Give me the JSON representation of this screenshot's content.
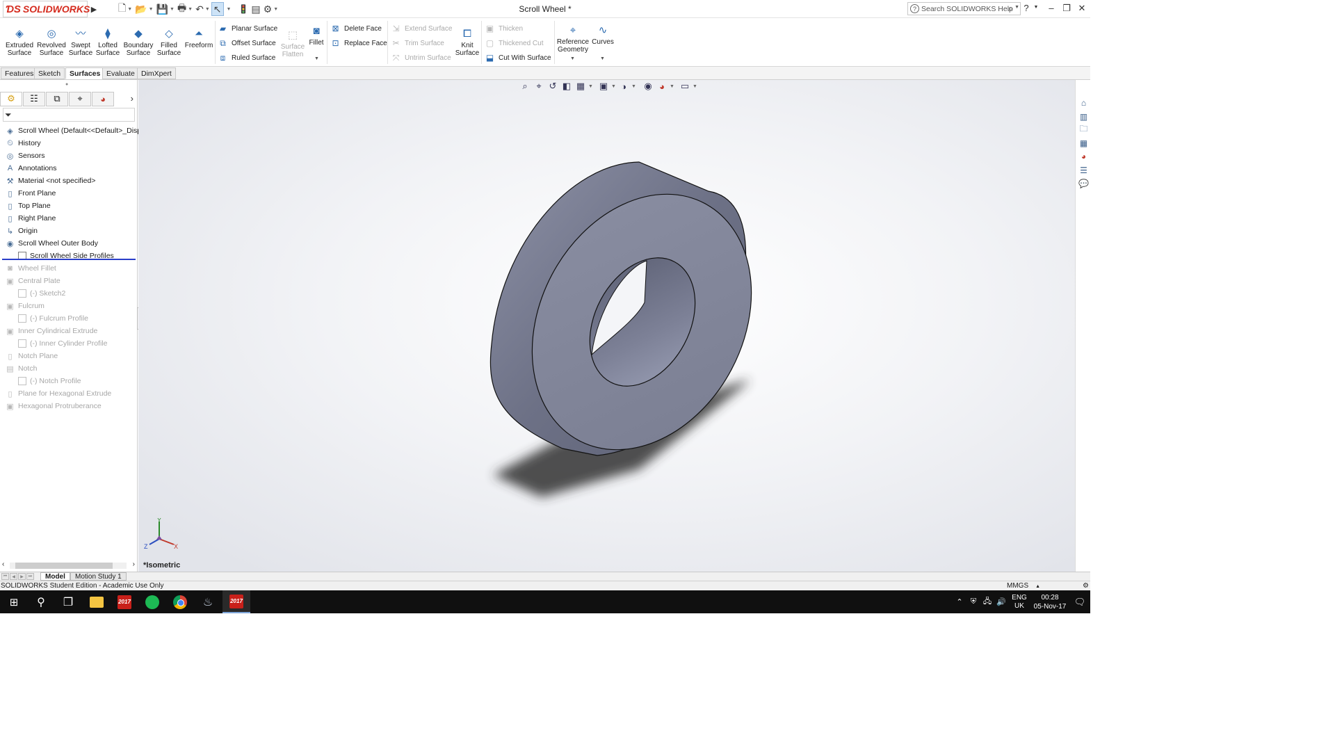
{
  "app": {
    "logo_text": "SOLIDWORKS",
    "document_title": "Scroll Wheel *",
    "help_search_placeholder": "Search SOLIDWORKS Help"
  },
  "ribbon": {
    "big_buttons": [
      {
        "label": "Extruded Surface",
        "icon": "extruded-surface-icon"
      },
      {
        "label": "Revolved Surface",
        "icon": "revolved-surface-icon"
      },
      {
        "label": "Swept Surface",
        "icon": "swept-surface-icon"
      },
      {
        "label": "Lofted Surface",
        "icon": "lofted-surface-icon"
      },
      {
        "label": "Boundary Surface",
        "icon": "boundary-surface-icon"
      },
      {
        "label": "Filled Surface",
        "icon": "filled-surface-icon"
      },
      {
        "label": "Freeform",
        "icon": "freeform-icon"
      }
    ],
    "group1": [
      "Planar Surface",
      "Offset Surface",
      "Ruled Surface"
    ],
    "surface_flatten": "Surface Flatten",
    "fillet": "Fillet",
    "group2": [
      "Delete Face",
      "Replace Face"
    ],
    "group3": [
      "Extend Surface",
      "Trim Surface",
      "Untrim Surface"
    ],
    "knit_surface": "Knit Surface",
    "group4": [
      "Thicken",
      "Thickened Cut",
      "Cut With Surface"
    ],
    "reference_geometry": "Reference Geometry",
    "curves": "Curves"
  },
  "tabs": [
    "Features",
    "Sketch",
    "Surfaces",
    "Evaluate",
    "DimXpert"
  ],
  "active_tab": "Surfaces",
  "tree": [
    {
      "label": "Scroll Wheel  (Default<<Default>_Displ",
      "icon": "part-icon",
      "suppressed": false,
      "indent": 0
    },
    {
      "label": "History",
      "icon": "history-icon",
      "suppressed": false,
      "indent": 0
    },
    {
      "label": "Sensors",
      "icon": "sensors-icon",
      "suppressed": false,
      "indent": 0
    },
    {
      "label": "Annotations",
      "icon": "annotations-icon",
      "suppressed": false,
      "indent": 0
    },
    {
      "label": "Material <not specified>",
      "icon": "material-icon",
      "suppressed": false,
      "indent": 0
    },
    {
      "label": "Front Plane",
      "icon": "plane-icon",
      "suppressed": false,
      "indent": 0
    },
    {
      "label": "Top Plane",
      "icon": "plane-icon",
      "suppressed": false,
      "indent": 0
    },
    {
      "label": "Right Plane",
      "icon": "plane-icon",
      "suppressed": false,
      "indent": 0
    },
    {
      "label": "Origin",
      "icon": "origin-icon",
      "suppressed": false,
      "indent": 0
    },
    {
      "label": "Scroll Wheel Outer Body",
      "icon": "revolve-feature-icon",
      "suppressed": false,
      "indent": 0
    },
    {
      "label": "Scroll Wheel Side Profiles",
      "icon": "sketch-icon",
      "suppressed": false,
      "indent": 1
    },
    {
      "label": "Wheel Fillet",
      "icon": "fillet-feature-icon",
      "suppressed": true,
      "indent": 0
    },
    {
      "label": "Central Plate",
      "icon": "extrude-feature-icon",
      "suppressed": true,
      "indent": 0
    },
    {
      "label": "(-) Sketch2",
      "icon": "sketch-icon",
      "suppressed": true,
      "indent": 1
    },
    {
      "label": "Fulcrum",
      "icon": "extrude-feature-icon",
      "suppressed": true,
      "indent": 0
    },
    {
      "label": "(-) Fulcrum Profile",
      "icon": "sketch-icon",
      "suppressed": true,
      "indent": 1
    },
    {
      "label": "Inner Cylindrical Extrude",
      "icon": "extrude-feature-icon",
      "suppressed": true,
      "indent": 0
    },
    {
      "label": "(-) Inner Cylinder Profile",
      "icon": "sketch-icon",
      "suppressed": true,
      "indent": 1
    },
    {
      "label": "Notch Plane",
      "icon": "plane-icon",
      "suppressed": true,
      "indent": 0
    },
    {
      "label": "Notch",
      "icon": "cut-feature-icon",
      "suppressed": true,
      "indent": 0
    },
    {
      "label": "(-) Notch Profile",
      "icon": "sketch-icon",
      "suppressed": true,
      "indent": 1
    },
    {
      "label": "Plane for Hexagonal Extrude",
      "icon": "plane-icon",
      "suppressed": true,
      "indent": 0
    },
    {
      "label": "Hexagonal Protruberance",
      "icon": "extrude-feature-icon",
      "suppressed": true,
      "indent": 0
    }
  ],
  "viewport": {
    "view_label": "*Isometric",
    "triad": {
      "x": "X",
      "y": "Y",
      "z": "Z"
    }
  },
  "bottom_tabs": [
    "Model",
    "Motion Study 1"
  ],
  "status": {
    "text": "SOLIDWORKS Student Edition - Academic Use Only",
    "units": "MMGS"
  },
  "taskbar": {
    "lang": "ENG",
    "region": "UK",
    "time": "00:28",
    "date": "05-Nov-17",
    "sw_year": "2017"
  }
}
